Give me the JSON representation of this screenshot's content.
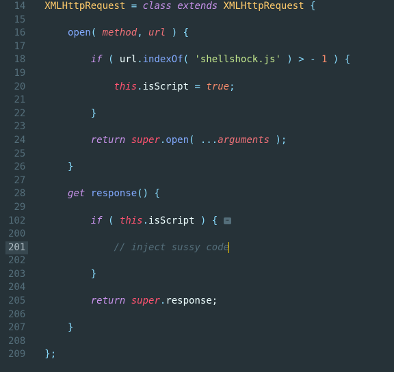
{
  "lineNumbers": [
    "14",
    "15",
    "16",
    "17",
    "18",
    "19",
    "20",
    "21",
    "22",
    "23",
    "24",
    "25",
    "26",
    "27",
    "28",
    "29",
    "102",
    "200",
    "201",
    "202",
    "203",
    "204",
    "205",
    "206",
    "207",
    "208",
    "209"
  ],
  "activeLine": "201",
  "code": {
    "l14": {
      "t0": "XMLHttpRequest",
      "t1": " = ",
      "t2": "class",
      "t3": " extends",
      "t4": " XMLHttpRequest",
      "t5": " {"
    },
    "l16": {
      "t0": "open",
      "t1": "(",
      "t2": " method",
      "t3": ",",
      "t4": " url",
      "t5": " )",
      "t6": " {"
    },
    "l18": {
      "t0": "if",
      "t1": " ( ",
      "t2": "url",
      "t3": ".",
      "t4": "indexOf",
      "t5": "( ",
      "t6": "'shellshock.js'",
      "t7": " ) ",
      "t8": ">",
      "t9": " - ",
      "t10": "1",
      "t11": " ) {"
    },
    "l20": {
      "t0": "this",
      "t1": ".",
      "t2": "isScript",
      "t3": " = ",
      "t4": "true",
      "t5": ";"
    },
    "l22": {
      "t0": "}"
    },
    "l24": {
      "t0": "return",
      "t1": " super",
      "t2": ".",
      "t3": "open",
      "t4": "( ",
      "t5": "...",
      "t6": "arguments",
      "t7": " );"
    },
    "l26": {
      "t0": "}"
    },
    "l28": {
      "t0": "get",
      "t1": " response",
      "t2": "()",
      "t3": " {"
    },
    "l102": {
      "t0": "if",
      "t1": " ( ",
      "t2": "this",
      "t3": ".",
      "t4": "isScript",
      "t5": " ) {",
      "fold": "⋯"
    },
    "l201": {
      "t0": "// inject sussy code"
    },
    "l203": {
      "t0": "}"
    },
    "l205": {
      "t0": "return",
      "t1": " super",
      "t2": ".",
      "t3": "response;"
    },
    "l207": {
      "t0": "}"
    },
    "l209": {
      "t0": "};"
    }
  }
}
